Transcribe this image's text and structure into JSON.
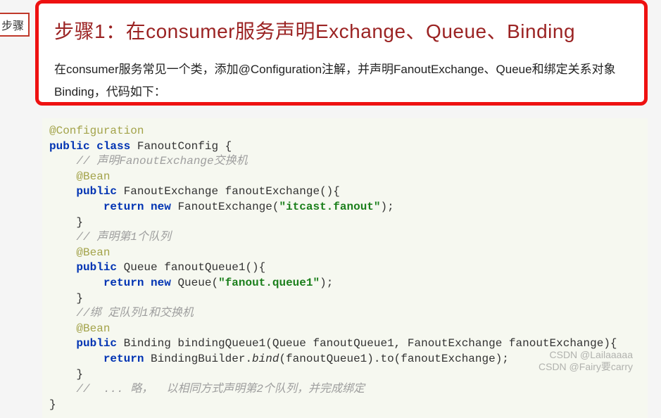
{
  "badge": "步骤",
  "title": "步骤1：在consumer服务声明Exchange、Queue、Binding",
  "description": "在consumer服务常见一个类，添加@Configuration注解，并声明FanoutExchange、Queue和绑定关系对象Binding，代码如下：",
  "code": {
    "annotation_config": "@Configuration",
    "class_sig_public": "public",
    "class_sig_class": "class",
    "class_name": "FanoutConfig {",
    "c1": "// 声明FanoutExchange交换机",
    "annotation_bean": "@Bean",
    "m1_public": "public",
    "m1_sig": " FanoutExchange fanoutExchange(){",
    "m1_return": "return",
    "m1_new": "new",
    "m1_call": " FanoutExchange(",
    "m1_str": "\"itcast.fanout\"",
    "m1_end": ");",
    "brace": "}",
    "c2": "// 声明第1个队列",
    "m2_public": "public",
    "m2_sig": " Queue fanoutQueue1(){",
    "m2_return": "return",
    "m2_new": "new",
    "m2_call": " Queue(",
    "m2_str": "\"fanout.queue1\"",
    "m2_end": ");",
    "c3": "//绑 定队列1和交换机",
    "m3_public": "public",
    "m3_sig": " Binding bindingQueue1(Queue fanoutQueue1, FanoutExchange fanoutExchange){",
    "m3_return": "return",
    "m3_body": " BindingBuilder.",
    "m3_bind": "bind",
    "m3_body2": "(fanoutQueue1).to(fanoutExchange);",
    "c4": "//  ... 略，  以相同方式声明第2个队列，并完成绑定"
  },
  "watermark1": "CSDN @Lailaaaaa",
  "watermark2": "CSDN @Fairy要carry"
}
